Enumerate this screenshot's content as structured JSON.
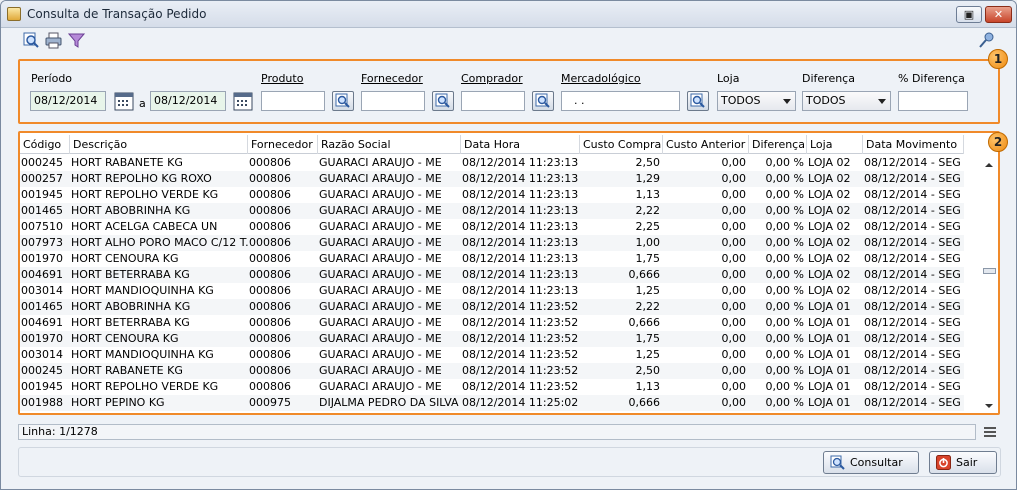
{
  "window": {
    "title": "Consulta de Transação Pedido",
    "restore_glyph": "▣",
    "close_glyph": "✕"
  },
  "toolbar": {
    "icons": [
      "search-icon",
      "print-icon",
      "filter-icon",
      "key-icon"
    ]
  },
  "filters": {
    "badge": "1",
    "periodo_label": "Período",
    "date_from": "08/12/2014",
    "sep_label": "a",
    "date_to": "08/12/2014",
    "produto_label": "Produto",
    "produto_value": "",
    "fornecedor_label": "Fornecedor",
    "fornecedor_value": "",
    "comprador_label": "Comprador",
    "comprador_value": "",
    "mercadologico_label": "Mercadológico",
    "mercadologico_value": ".   .",
    "loja_label": "Loja",
    "loja_value": "TODOS",
    "diferenca_label": "Diferença",
    "diferenca_value": "TODOS",
    "pct_diferenca_label": "% Diferença",
    "pct_diferenca_value": ""
  },
  "grid": {
    "badge": "2",
    "columns": [
      "Código",
      "Descrição",
      "Fornecedor",
      "Razão Social",
      "Data Hora",
      "Custo Compra",
      "Custo Anterior",
      "Diferença",
      "Loja",
      "Data Movimento"
    ],
    "rows": [
      [
        "000245",
        "HORT RABANETE KG",
        "000806",
        "GUARACI ARAUJO - ME",
        "08/12/2014 11:23:13",
        "2,50",
        "0,00",
        "0,00 %",
        "LOJA 02",
        "08/12/2014 - SEG"
      ],
      [
        "000257",
        "HORT REPOLHO KG ROXO",
        "000806",
        "GUARACI ARAUJO - ME",
        "08/12/2014 11:23:13",
        "1,29",
        "0,00",
        "0,00 %",
        "LOJA 02",
        "08/12/2014 - SEG"
      ],
      [
        "001945",
        "HORT REPOLHO VERDE KG",
        "000806",
        "GUARACI ARAUJO - ME",
        "08/12/2014 11:23:13",
        "1,13",
        "0,00",
        "0,00 %",
        "LOJA 02",
        "08/12/2014 - SEG"
      ],
      [
        "001465",
        "HORT ABOBRINHA KG",
        "000806",
        "GUARACI ARAUJO - ME",
        "08/12/2014 11:23:13",
        "2,22",
        "0,00",
        "0,00 %",
        "LOJA 02",
        "08/12/2014 - SEG"
      ],
      [
        "007510",
        "HORT ACELGA CABECA UN",
        "000806",
        "GUARACI ARAUJO - ME",
        "08/12/2014 11:23:13",
        "2,25",
        "0,00",
        "0,00 %",
        "LOJA 02",
        "08/12/2014 - SEG"
      ],
      [
        "007973",
        "HORT ALHO PORO MACO C/12 T...",
        "000806",
        "GUARACI ARAUJO - ME",
        "08/12/2014 11:23:13",
        "1,00",
        "0,00",
        "0,00 %",
        "LOJA 02",
        "08/12/2014 - SEG"
      ],
      [
        "001970",
        "HORT CENOURA KG",
        "000806",
        "GUARACI ARAUJO - ME",
        "08/12/2014 11:23:13",
        "1,75",
        "0,00",
        "0,00 %",
        "LOJA 02",
        "08/12/2014 - SEG"
      ],
      [
        "004691",
        "HORT BETERRABA KG",
        "000806",
        "GUARACI ARAUJO - ME",
        "08/12/2014 11:23:13",
        "0,666",
        "0,00",
        "0,00 %",
        "LOJA 02",
        "08/12/2014 - SEG"
      ],
      [
        "003014",
        "HORT MANDIOQUINHA KG",
        "000806",
        "GUARACI ARAUJO - ME",
        "08/12/2014 11:23:13",
        "1,25",
        "0,00",
        "0,00 %",
        "LOJA 02",
        "08/12/2014 - SEG"
      ],
      [
        "001465",
        "HORT ABOBRINHA KG",
        "000806",
        "GUARACI ARAUJO - ME",
        "08/12/2014 11:23:52",
        "2,22",
        "0,00",
        "0,00 %",
        "LOJA 01",
        "08/12/2014 - SEG"
      ],
      [
        "004691",
        "HORT BETERRABA KG",
        "000806",
        "GUARACI ARAUJO - ME",
        "08/12/2014 11:23:52",
        "0,666",
        "0,00",
        "0,00 %",
        "LOJA 01",
        "08/12/2014 - SEG"
      ],
      [
        "001970",
        "HORT CENOURA KG",
        "000806",
        "GUARACI ARAUJO - ME",
        "08/12/2014 11:23:52",
        "1,75",
        "0,00",
        "0,00 %",
        "LOJA 01",
        "08/12/2014 - SEG"
      ],
      [
        "003014",
        "HORT MANDIOQUINHA KG",
        "000806",
        "GUARACI ARAUJO - ME",
        "08/12/2014 11:23:52",
        "1,25",
        "0,00",
        "0,00 %",
        "LOJA 01",
        "08/12/2014 - SEG"
      ],
      [
        "000245",
        "HORT RABANETE KG",
        "000806",
        "GUARACI ARAUJO - ME",
        "08/12/2014 11:23:52",
        "2,50",
        "0,00",
        "0,00 %",
        "LOJA 01",
        "08/12/2014 - SEG"
      ],
      [
        "001945",
        "HORT REPOLHO VERDE KG",
        "000806",
        "GUARACI ARAUJO - ME",
        "08/12/2014 11:23:52",
        "1,13",
        "0,00",
        "0,00 %",
        "LOJA 01",
        "08/12/2014 - SEG"
      ],
      [
        "001988",
        "HORT PEPINO KG",
        "000975",
        "DIJALMA PEDRO DA SILVA",
        "08/12/2014 11:25:02",
        "0,666",
        "0,00",
        "0,00 %",
        "LOJA 01",
        "08/12/2014 - SEG"
      ]
    ]
  },
  "status": {
    "linha": "Linha: 1/1278"
  },
  "buttons": {
    "consultar": "Consultar",
    "sair": "Sair"
  },
  "colors": {
    "accent_border": "#f08a2a",
    "date_bg": "#e8f5ea"
  }
}
